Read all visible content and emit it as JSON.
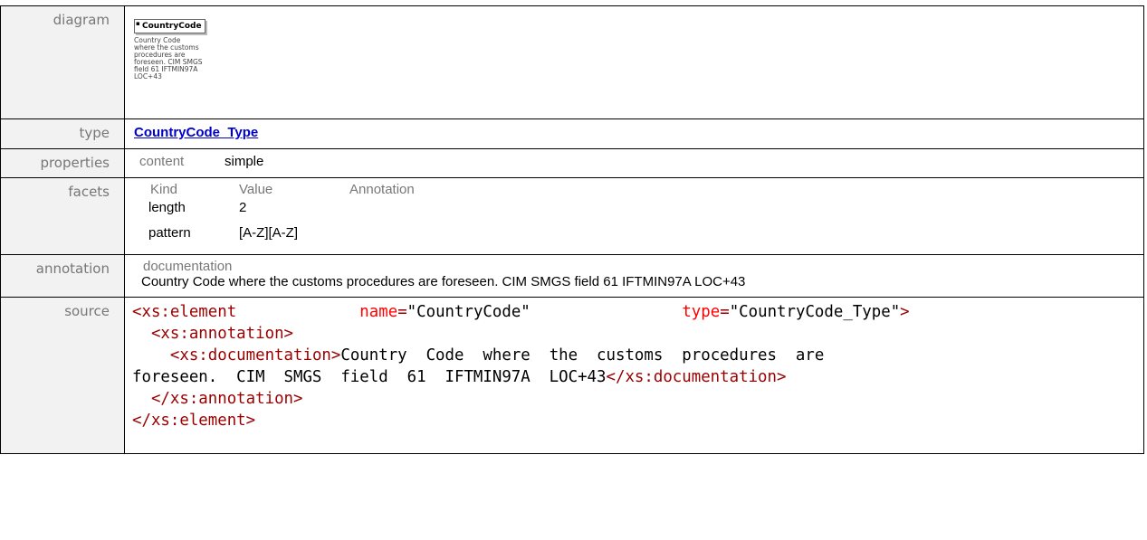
{
  "rows": {
    "diagram": {
      "label": "diagram"
    },
    "type": {
      "label": "type",
      "link": "CountryCode_Type"
    },
    "properties": {
      "label": "properties",
      "key": "content",
      "value": "simple"
    },
    "facets": {
      "label": "facets",
      "headers": [
        "Kind",
        "Value",
        "Annotation"
      ],
      "items": [
        {
          "kind": "length",
          "value": "2"
        },
        {
          "kind": "pattern",
          "value": "[A-Z][A-Z]"
        }
      ]
    },
    "annotation": {
      "label": "annotation",
      "head": "documentation",
      "text": "Country Code where the customs procedures are foreseen. CIM SMGS field 61 IFTMIN97A LOC+43"
    },
    "source": {
      "label": "source"
    }
  },
  "diagram": {
    "element_name": "CountryCode",
    "doc_text": "Country Code where the customs procedures are foreseen. CIM SMGS field 61 IFTMIN97A LOC+43"
  },
  "source": {
    "line1": {
      "open": "<xs:element",
      "attr1": "name",
      "val1": "\"CountryCode\"",
      "attr2": "type",
      "val2": "\"CountryCode_Type\"",
      "close": ">"
    },
    "line2": "<xs:annotation>",
    "line3_tag": "<xs:documentation>",
    "line3_text": "Country  Code  where  the  customs  procedures  are",
    "line4_text": "foreseen.  CIM  SMGS  field  61  IFTMIN97A  LOC+43",
    "line4_tag": "</xs:documentation>",
    "line5": "</xs:annotation>",
    "line6": "</xs:element>"
  }
}
